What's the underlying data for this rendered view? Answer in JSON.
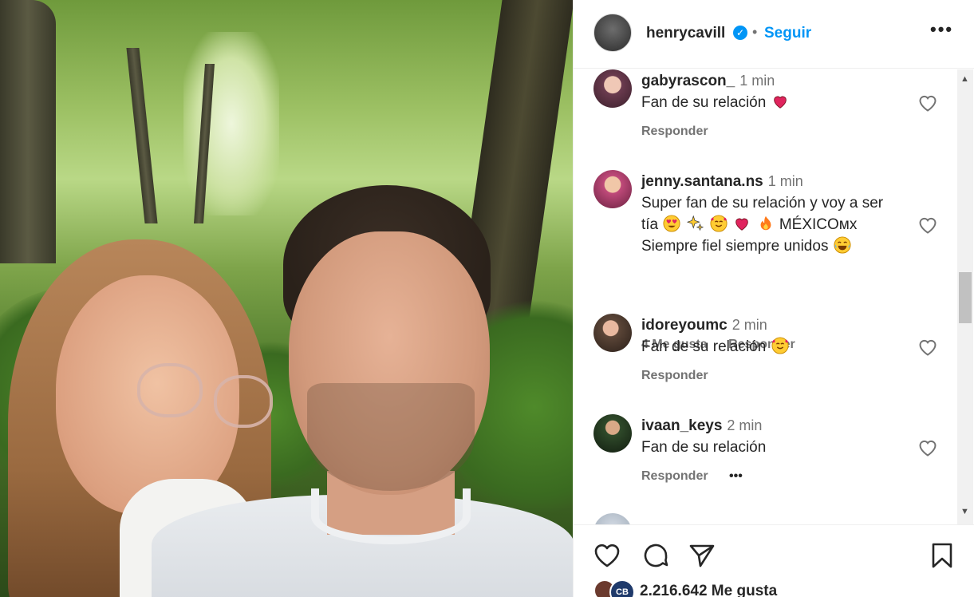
{
  "post": {
    "username": "henrycavill",
    "verified_glyph": "✓",
    "separator": "•",
    "follow_label": "Seguir",
    "more_label": "•••"
  },
  "comments": [
    {
      "user": "gabyrascon_",
      "time": "1 min",
      "text": "Fan de su relación",
      "actions": [
        "Responder"
      ],
      "avatar_color": "#6b3b4f"
    },
    {
      "user": "jenny.santana.ns",
      "time": "1 min",
      "text_line1": "Super fan de su relación y voy a ser",
      "text_line2_prefix": "tía",
      "text_line2_suffix": "MÉXICOᴍx",
      "text_line3": "Siempre fiel siempre unidos",
      "actions": [
        "4 Me gusta",
        "Responder"
      ],
      "avatar_color": "#c04a7a"
    },
    {
      "user": "idoreyoumc",
      "time": "2 min",
      "text": "Fan de su relación",
      "actions": [
        "Responder"
      ],
      "avatar_color": "#5c4638"
    },
    {
      "user": "ivaan_keys",
      "time": "2 min",
      "text": "Fan de su relación",
      "actions": [
        "Responder",
        "•••"
      ],
      "avatar_color": "#2f4a2a"
    }
  ],
  "footer": {
    "likes_text": "2.216.642 Me gusta",
    "liker_badge": "CB"
  },
  "icons": [
    "heart-icon",
    "comment-icon",
    "share-icon",
    "bookmark-icon",
    "more-icon",
    "verified-icon"
  ],
  "colors": {
    "accent": "#0095f6",
    "text": "#262626",
    "secondary": "#737373",
    "heart_red": "#e0245e"
  }
}
